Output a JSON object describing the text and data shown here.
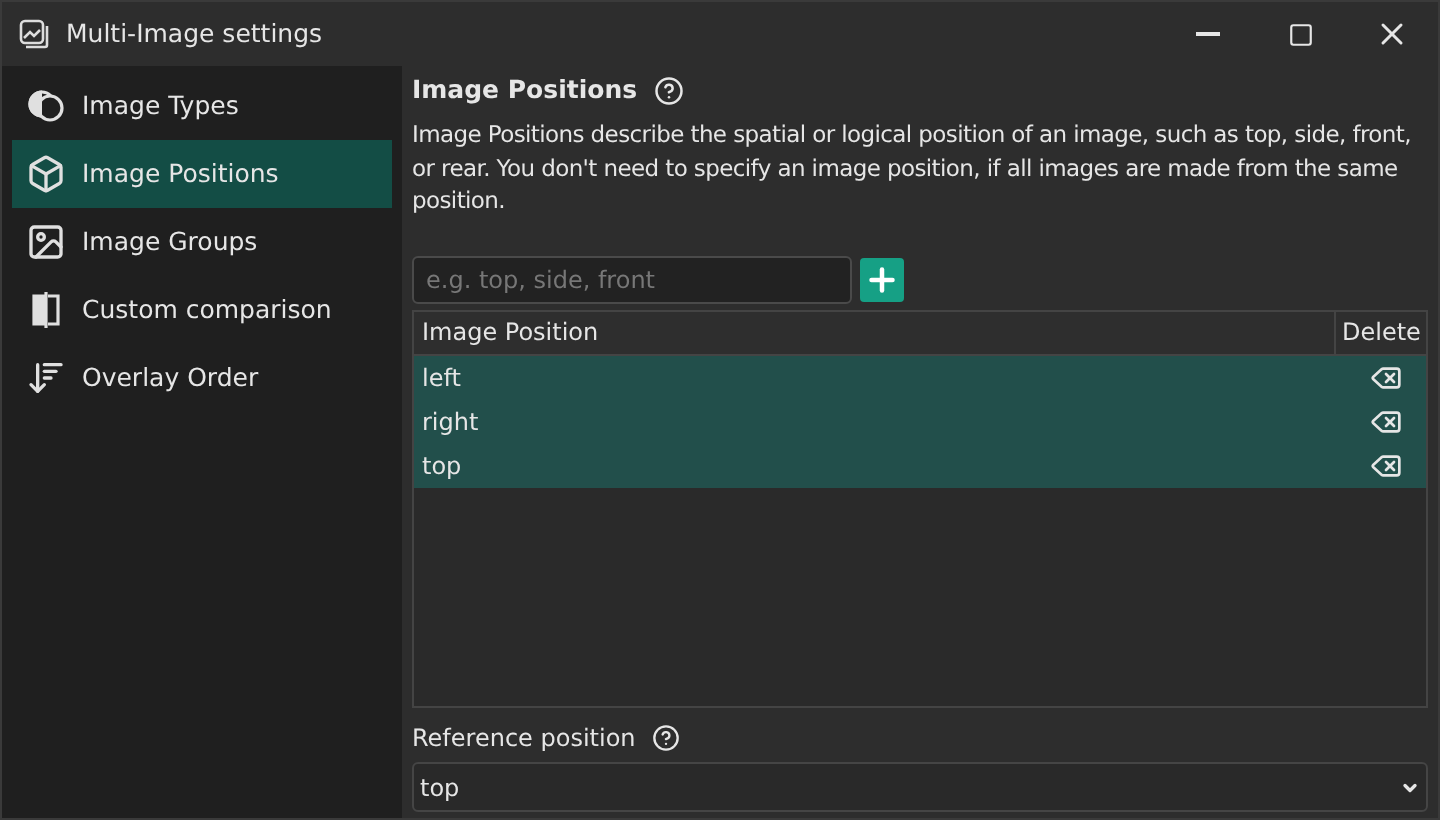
{
  "window": {
    "title": "Multi-Image settings"
  },
  "sidebar": {
    "items": [
      {
        "label": "Image Types",
        "kind": "types",
        "selected": false
      },
      {
        "label": "Image Positions",
        "kind": "cube",
        "selected": true
      },
      {
        "label": "Image Groups",
        "kind": "image",
        "selected": false
      },
      {
        "label": "Custom comparison",
        "kind": "compare",
        "selected": false
      },
      {
        "label": "Overlay Order",
        "kind": "sort",
        "selected": false
      }
    ]
  },
  "content": {
    "title": "Image Positions",
    "description": "Image Positions describe the spatial or logical position of an image, such as top, side, front, or rear. You don't need to specify an image position, if all images are made from the same position.",
    "input": {
      "placeholder": "e.g. top, side, front"
    },
    "table": {
      "columns": [
        "Image Position",
        "Delete"
      ],
      "rows": [
        {
          "value": "left",
          "selected": true
        },
        {
          "value": "right",
          "selected": true
        },
        {
          "value": "top",
          "selected": true
        }
      ]
    },
    "reference": {
      "label": "Reference position",
      "value": "top"
    }
  }
}
